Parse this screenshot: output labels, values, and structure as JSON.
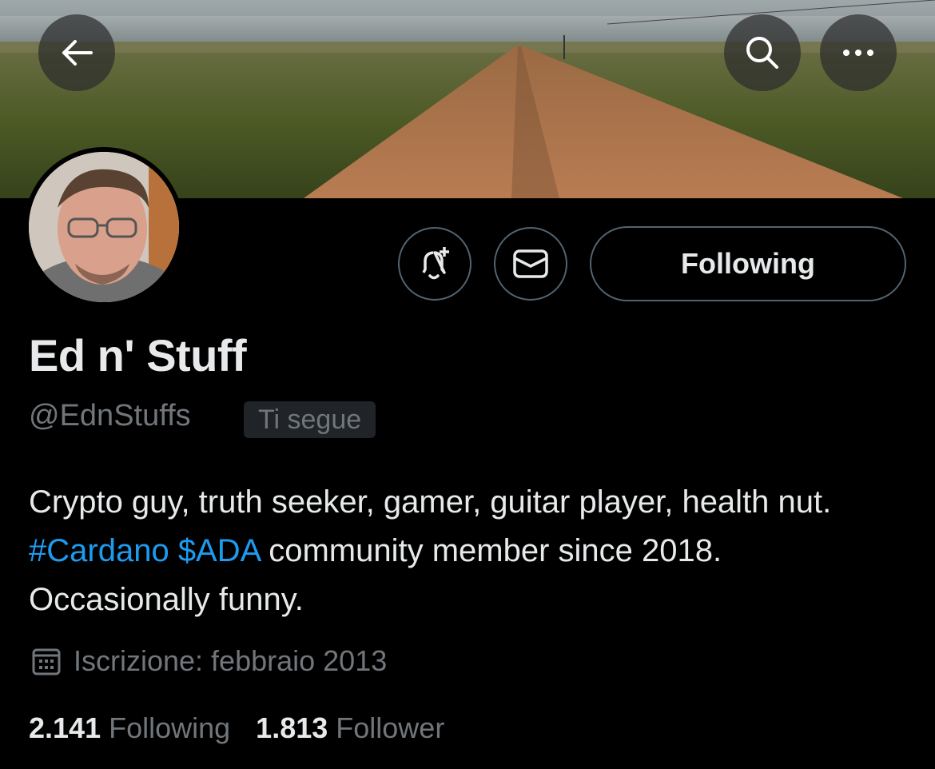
{
  "header": {
    "back_icon": "arrow-left-icon",
    "search_icon": "search-icon",
    "more_icon": "more-horizontal-icon"
  },
  "actions": {
    "notify_icon": "bell-plus-icon",
    "message_icon": "mail-icon",
    "follow_label": "Following"
  },
  "profile": {
    "name": "Ed n' Stuff",
    "handle": "@EdnStuffs",
    "follows_you_badge": "Ti segue",
    "bio": {
      "part1": "Crypto guy, truth seeker, gamer, guitar player, health nut. ",
      "hashtag": "#Cardano",
      "space": " ",
      "cashtag": "$ADA",
      "part2": " community member since 2018. Occasionally funny."
    },
    "joined": "Iscrizione: febbraio 2013",
    "stats": {
      "following_count": "2.141",
      "following_label": "Following",
      "followers_count": "1.813",
      "followers_label": "Follower"
    }
  },
  "colors": {
    "background": "#000000",
    "text": "#e7e9ea",
    "muted": "#71767b",
    "link": "#1d9bf0",
    "border": "#536471"
  }
}
